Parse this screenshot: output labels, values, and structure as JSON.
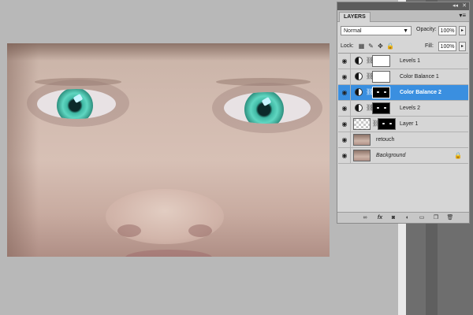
{
  "panel": {
    "tab_label": "LAYERS",
    "collapse_glyph": "◂◂",
    "close_glyph": "✕",
    "menu_glyph": "▾≡",
    "blend_mode": "Normal",
    "opacity_label": "Opacity:",
    "opacity_value": "100%",
    "lock_label": "Lock:",
    "fill_label": "Fill:",
    "fill_value": "100%"
  },
  "layers": [
    {
      "name": "Levels 1",
      "type": "adjustment",
      "mask": "white",
      "selected": false
    },
    {
      "name": "Color Balance 1",
      "type": "adjustment",
      "mask": "white",
      "selected": false
    },
    {
      "name": "Color Balance 2",
      "type": "adjustment",
      "mask": "black",
      "selected": true
    },
    {
      "name": "Levels 2",
      "type": "adjustment",
      "mask": "black",
      "selected": false
    },
    {
      "name": "Layer 1",
      "type": "pixel",
      "mask": "black",
      "selected": false
    },
    {
      "name": "retouch",
      "type": "pixel",
      "selected": false
    },
    {
      "name": "Background",
      "type": "background",
      "selected": false
    }
  ],
  "colors": {
    "selection": "#3a8fe0",
    "panel_bg": "#d6d6d6",
    "canvas_bg": "#b8b8b8",
    "iris": "#3fb7a3"
  },
  "icons": {
    "visibility": "eye-icon",
    "adjustment": "adjustment-layer-icon",
    "link": "chain-link-icon",
    "lock": "lock-icon",
    "footer": [
      "link-layers-icon",
      "fx-icon",
      "add-mask-icon",
      "new-adjustment-icon",
      "new-group-icon",
      "new-layer-icon",
      "trash-icon"
    ]
  }
}
